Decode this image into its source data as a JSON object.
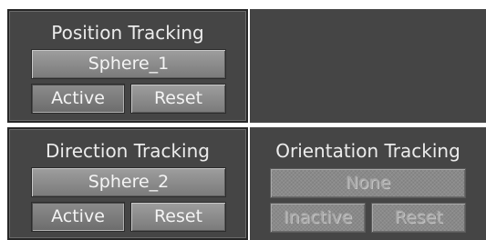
{
  "position_tracking": {
    "title": "Position Tracking",
    "target": "Sphere_1",
    "active_label": "Active",
    "reset_label": "Reset"
  },
  "direction_tracking": {
    "title": "Direction Tracking",
    "target": "Sphere_2",
    "active_label": "Active",
    "reset_label": "Reset"
  },
  "orientation_tracking": {
    "title": "Orientation Tracking",
    "target": "None",
    "state_label": "Inactive",
    "reset_label": "Reset"
  },
  "colors": {
    "panel_background": "#454545",
    "button_face": "#8a8a8a",
    "text": "#ececec"
  }
}
